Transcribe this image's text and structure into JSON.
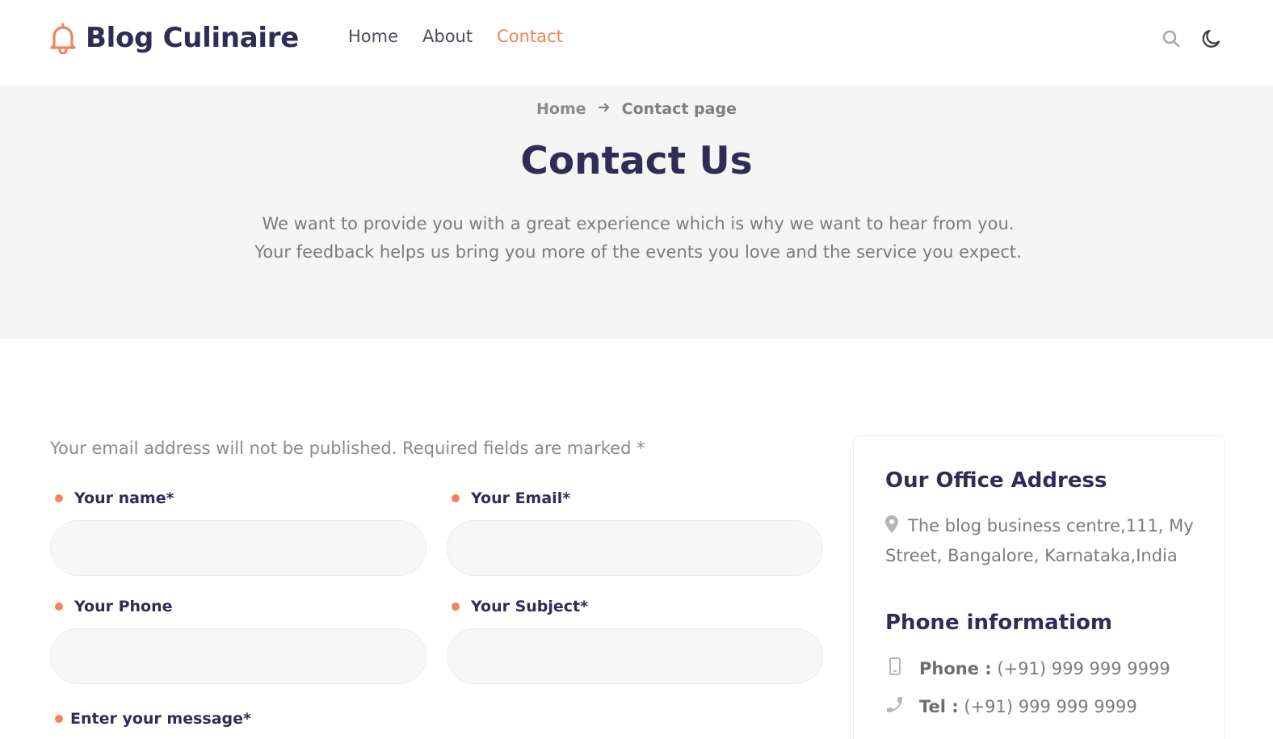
{
  "header": {
    "brand": "Blog Culinaire",
    "nav": [
      {
        "label": "Home",
        "active": false
      },
      {
        "label": "About",
        "active": false
      },
      {
        "label": "Contact",
        "active": true
      }
    ],
    "icons": [
      "search-icon",
      "dark-mode-moon-icon"
    ]
  },
  "hero": {
    "breadcrumb": {
      "home": "Home",
      "current": "Contact page"
    },
    "title": "Contact Us",
    "description": "We want to provide you with a great experience which is why we want to hear from you. Your feedback helps us bring you more of the events you love and the service you expect."
  },
  "form": {
    "note": "Your email address will not be published. Required fields are marked *",
    "fields": {
      "name": {
        "label": "Your name*",
        "value": ""
      },
      "email": {
        "label": "Your Email*",
        "value": ""
      },
      "phone": {
        "label": "Your Phone",
        "value": ""
      },
      "subject": {
        "label": "Your Subject*",
        "value": ""
      },
      "message": {
        "label": "Enter your message*",
        "value": ""
      }
    }
  },
  "sidebar": {
    "office_title": "Our Office Address",
    "address": "The blog business centre,111, My Street, Bangalore, Karnataka,India",
    "phone_title": "Phone informatiom",
    "phone_label": "Phone :",
    "phone_value": "(+91) 999 999 9999",
    "tel_label": "Tel :",
    "tel_value": "(+91) 999 999 9999"
  },
  "colors": {
    "accent": "#f4825d",
    "heading": "#2f2c55",
    "hero_bg": "#f5f5f6"
  }
}
